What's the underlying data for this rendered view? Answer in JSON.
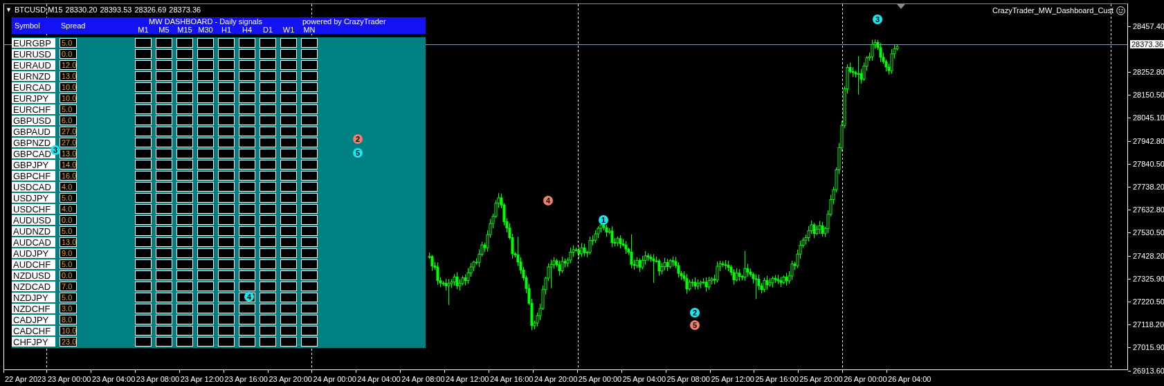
{
  "chart_header": {
    "menu_glyph": "▼",
    "symbol": "BTCUSD,M15",
    "ohlc": [
      "28330.20",
      "28393.53",
      "28326.69",
      "28373.36"
    ]
  },
  "indicator_label": "CrazyTrader_MW_Dashboard_Cust",
  "dashboard": {
    "symbol_heading": "Symbol",
    "spread_heading": "Spread",
    "title": "MW DASHBOARD - Daily signals",
    "credit": "powered by CrazyTrader",
    "timeframes": [
      "M1",
      "M5",
      "M15",
      "M30",
      "H1",
      "H4",
      "D1",
      "W1",
      "MN"
    ],
    "rows": [
      {
        "symbol": "EURGBP",
        "spread": "5.0"
      },
      {
        "symbol": "EURUSD",
        "spread": "0.0"
      },
      {
        "symbol": "EURAUD",
        "spread": "12.0"
      },
      {
        "symbol": "EURNZD",
        "spread": "13.0"
      },
      {
        "symbol": "EURCAD",
        "spread": "10.0"
      },
      {
        "symbol": "EURJPY",
        "spread": "10.0"
      },
      {
        "symbol": "EURCHF",
        "spread": "5.0"
      },
      {
        "symbol": "GBPUSD",
        "spread": "6.0"
      },
      {
        "symbol": "GBPAUD",
        "spread": "27.0"
      },
      {
        "symbol": "GBPNZD",
        "spread": "27.0"
      },
      {
        "symbol": "GBPCAD",
        "spread": "13.0"
      },
      {
        "symbol": "GBPJPY",
        "spread": "14.0"
      },
      {
        "symbol": "GBPCHF",
        "spread": "16.0"
      },
      {
        "symbol": "USDCAD",
        "spread": "4.0"
      },
      {
        "symbol": "USDJPY",
        "spread": "5.0"
      },
      {
        "symbol": "USDCHF",
        "spread": "4.0"
      },
      {
        "symbol": "AUDUSD",
        "spread": "0.0"
      },
      {
        "symbol": "AUDNZD",
        "spread": "5.0"
      },
      {
        "symbol": "AUDCAD",
        "spread": "13.0"
      },
      {
        "symbol": "AUDJPY",
        "spread": "9.0"
      },
      {
        "symbol": "AUDCHF",
        "spread": "5.0"
      },
      {
        "symbol": "NZDUSD",
        "spread": "0.0"
      },
      {
        "symbol": "NZDCAD",
        "spread": "7.0"
      },
      {
        "symbol": "NZDJPY",
        "spread": "5.0"
      },
      {
        "symbol": "NZDCHF",
        "spread": "3.0"
      },
      {
        "symbol": "CADJPY",
        "spread": "8.0"
      },
      {
        "symbol": "CADCHF",
        "spread": "10.0"
      },
      {
        "symbol": "CHFJPY",
        "spread": "23.0"
      }
    ]
  },
  "markers": [
    {
      "label": "3",
      "color": "#19e6f0"
    },
    {
      "label": "2",
      "color": "#f07f6b"
    },
    {
      "label": "5",
      "color": "#19e6f0"
    },
    {
      "label": "4",
      "color": "#19e6f0"
    },
    {
      "label": "4",
      "color": "#f07f6b"
    },
    {
      "label": "1",
      "color": "#19e6f0"
    },
    {
      "label": "2",
      "color": "#19e6f0"
    },
    {
      "label": "5",
      "color": "#f07f6b"
    },
    {
      "label": "3",
      "color": "#19e6f0"
    }
  ],
  "price_axis": {
    "labels": [
      "28457.40",
      "28252.80",
      "28150.50",
      "28045.10",
      "27942.80",
      "27840.50",
      "27738.20",
      "27632.80",
      "27530.50",
      "27428.20",
      "27325.90",
      "27220.50",
      "27118.20",
      "27015.90",
      "26913.60"
    ],
    "current_price": "28373.36"
  },
  "time_axis": {
    "labels": [
      "22 Apr 2023",
      "23 Apr 00:00",
      "23 Apr 04:00",
      "23 Apr 08:00",
      "23 Apr 12:00",
      "23 Apr 16:00",
      "23 Apr 20:00",
      "24 Apr 00:00",
      "24 Apr 04:00",
      "24 Apr 08:00",
      "24 Apr 12:00",
      "24 Apr 16:00",
      "24 Apr 20:00",
      "25 Apr 00:00",
      "25 Apr 04:00",
      "25 Apr 08:00",
      "25 Apr 12:00",
      "25 Apr 16:00",
      "25 Apr 20:00",
      "26 Apr 00:00",
      "26 Apr 04:00"
    ]
  }
}
